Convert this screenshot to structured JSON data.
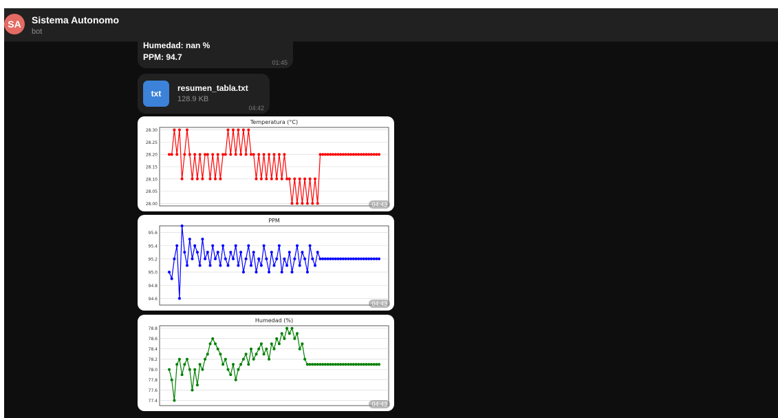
{
  "header": {
    "avatar_initials": "SA",
    "title": "Sistema Autonomo",
    "subtitle": "bot",
    "avatar_color": "#e46b63"
  },
  "messages": {
    "readings": {
      "humidity_line": "Humedad: nan %",
      "ppm_line": "PPM: 94.7",
      "time": "01:45"
    },
    "file": {
      "icon_label": "txt",
      "name": "resumen_tabla.txt",
      "size": "128.9 KB",
      "time": "04:42",
      "icon_color": "#3b82d8"
    }
  },
  "chart_data": [
    {
      "type": "line",
      "title": "Temperatura (°C)",
      "color": "#ff0000",
      "ylim": [
        27.99,
        28.31
      ],
      "yticks": [
        "28.30",
        "28.25",
        "28.20",
        "28.15",
        "28.10",
        "28.05",
        "28.00"
      ],
      "time": "04:43",
      "series": [
        {
          "values": [
            28.2,
            28.2,
            28.3,
            28.2,
            28.3,
            28.1,
            28.2,
            28.3,
            28.2,
            28.1,
            28.2,
            28.1,
            28.2,
            28.1,
            28.2,
            28.2,
            28.1,
            28.2,
            28.1,
            28.2,
            28.1,
            28.2,
            28.2,
            28.3,
            28.2,
            28.3,
            28.2,
            28.3,
            28.2,
            28.3,
            28.2,
            28.3,
            28.2,
            28.2,
            28.1,
            28.2,
            28.1,
            28.2,
            28.1,
            28.2,
            28.1,
            28.2,
            28.1,
            28.2,
            28.1,
            28.2,
            28.1,
            28.1,
            28.0,
            28.1,
            28.0,
            28.1,
            28.0,
            28.1,
            28.0,
            28.1,
            28.0,
            28.1,
            28.0,
            28.2,
            28.2,
            28.2,
            28.2,
            28.2,
            28.2,
            28.2,
            28.2,
            28.2,
            28.2,
            28.2,
            28.2,
            28.2,
            28.2,
            28.2,
            28.2,
            28.2,
            28.2,
            28.2,
            28.2,
            28.2,
            28.2,
            28.2,
            28.2
          ]
        }
      ]
    },
    {
      "type": "line",
      "title": "PPM",
      "color": "#0000ff",
      "ylim": [
        94.5,
        95.7
      ],
      "yticks": [
        "95.6",
        "95.4",
        "95.2",
        "95.0",
        "94.8",
        "94.6"
      ],
      "time": "04:43",
      "series": [
        {
          "values": [
            95.0,
            94.9,
            95.2,
            95.4,
            94.6,
            95.7,
            95.3,
            95.1,
            95.5,
            95.2,
            95.4,
            95.3,
            95.1,
            95.5,
            95.2,
            95.3,
            95.1,
            95.4,
            95.2,
            95.3,
            95.1,
            95.4,
            95.2,
            95.1,
            95.3,
            95.2,
            95.4,
            95.1,
            95.3,
            95.0,
            95.2,
            95.4,
            95.1,
            95.3,
            95.0,
            95.2,
            95.1,
            95.4,
            95.2,
            95.0,
            95.3,
            95.1,
            95.2,
            95.4,
            95.0,
            95.2,
            95.1,
            95.3,
            95.0,
            95.2,
            95.4,
            95.1,
            95.3,
            95.2,
            95.0,
            95.4,
            95.2,
            95.1,
            95.3,
            95.2,
            95.2,
            95.2,
            95.2,
            95.2,
            95.2,
            95.2,
            95.2,
            95.2,
            95.2,
            95.2,
            95.2,
            95.2,
            95.2,
            95.2,
            95.2,
            95.2,
            95.2,
            95.2,
            95.2,
            95.2,
            95.2,
            95.2,
            95.2
          ]
        }
      ]
    },
    {
      "type": "line",
      "title": "Humedad (%)",
      "color": "#008000",
      "ylim": [
        77.3,
        78.85
      ],
      "yticks": [
        "78.8",
        "78.6",
        "78.4",
        "78.2",
        "78.0",
        "77.8",
        "77.6",
        "77.4"
      ],
      "time": "04:43",
      "series": [
        {
          "values": [
            78.0,
            77.8,
            77.4,
            78.1,
            78.2,
            77.9,
            78.1,
            78.2,
            78.0,
            77.6,
            78.0,
            77.7,
            78.1,
            78.0,
            78.2,
            78.3,
            78.5,
            78.6,
            78.5,
            78.4,
            78.3,
            78.1,
            78.2,
            78.0,
            77.9,
            78.1,
            77.8,
            78.0,
            78.1,
            78.2,
            78.3,
            78.1,
            78.4,
            78.2,
            78.3,
            78.4,
            78.5,
            78.3,
            78.4,
            78.2,
            78.5,
            78.4,
            78.6,
            78.5,
            78.7,
            78.6,
            78.8,
            78.7,
            78.8,
            78.6,
            78.7,
            78.4,
            78.5,
            78.2,
            78.1,
            78.1,
            78.1,
            78.1,
            78.1,
            78.1,
            78.1,
            78.1,
            78.1,
            78.1,
            78.1,
            78.1,
            78.1,
            78.1,
            78.1,
            78.1,
            78.1,
            78.1,
            78.1,
            78.1,
            78.1,
            78.1,
            78.1,
            78.1,
            78.1,
            78.1,
            78.1,
            78.1,
            78.1
          ]
        }
      ]
    }
  ]
}
